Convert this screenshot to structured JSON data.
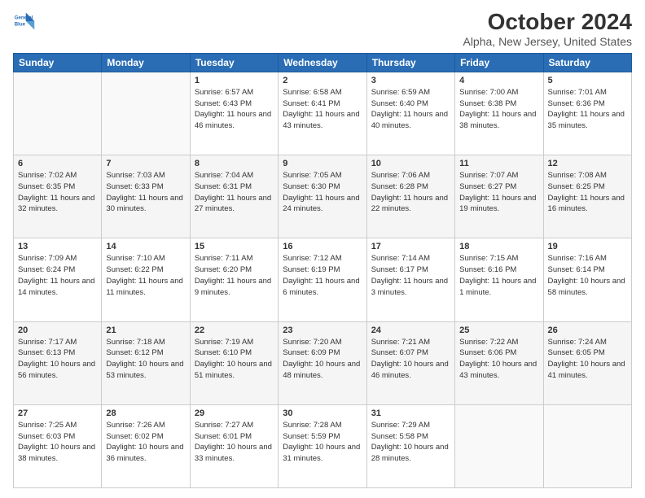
{
  "logo": {
    "line1": "General",
    "line2": "Blue"
  },
  "title": "October 2024",
  "subtitle": "Alpha, New Jersey, United States",
  "days_of_week": [
    "Sunday",
    "Monday",
    "Tuesday",
    "Wednesday",
    "Thursday",
    "Friday",
    "Saturday"
  ],
  "weeks": [
    [
      {
        "day": "",
        "info": ""
      },
      {
        "day": "",
        "info": ""
      },
      {
        "day": "1",
        "info": "Sunrise: 6:57 AM\nSunset: 6:43 PM\nDaylight: 11 hours and 46 minutes."
      },
      {
        "day": "2",
        "info": "Sunrise: 6:58 AM\nSunset: 6:41 PM\nDaylight: 11 hours and 43 minutes."
      },
      {
        "day": "3",
        "info": "Sunrise: 6:59 AM\nSunset: 6:40 PM\nDaylight: 11 hours and 40 minutes."
      },
      {
        "day": "4",
        "info": "Sunrise: 7:00 AM\nSunset: 6:38 PM\nDaylight: 11 hours and 38 minutes."
      },
      {
        "day": "5",
        "info": "Sunrise: 7:01 AM\nSunset: 6:36 PM\nDaylight: 11 hours and 35 minutes."
      }
    ],
    [
      {
        "day": "6",
        "info": "Sunrise: 7:02 AM\nSunset: 6:35 PM\nDaylight: 11 hours and 32 minutes."
      },
      {
        "day": "7",
        "info": "Sunrise: 7:03 AM\nSunset: 6:33 PM\nDaylight: 11 hours and 30 minutes."
      },
      {
        "day": "8",
        "info": "Sunrise: 7:04 AM\nSunset: 6:31 PM\nDaylight: 11 hours and 27 minutes."
      },
      {
        "day": "9",
        "info": "Sunrise: 7:05 AM\nSunset: 6:30 PM\nDaylight: 11 hours and 24 minutes."
      },
      {
        "day": "10",
        "info": "Sunrise: 7:06 AM\nSunset: 6:28 PM\nDaylight: 11 hours and 22 minutes."
      },
      {
        "day": "11",
        "info": "Sunrise: 7:07 AM\nSunset: 6:27 PM\nDaylight: 11 hours and 19 minutes."
      },
      {
        "day": "12",
        "info": "Sunrise: 7:08 AM\nSunset: 6:25 PM\nDaylight: 11 hours and 16 minutes."
      }
    ],
    [
      {
        "day": "13",
        "info": "Sunrise: 7:09 AM\nSunset: 6:24 PM\nDaylight: 11 hours and 14 minutes."
      },
      {
        "day": "14",
        "info": "Sunrise: 7:10 AM\nSunset: 6:22 PM\nDaylight: 11 hours and 11 minutes."
      },
      {
        "day": "15",
        "info": "Sunrise: 7:11 AM\nSunset: 6:20 PM\nDaylight: 11 hours and 9 minutes."
      },
      {
        "day": "16",
        "info": "Sunrise: 7:12 AM\nSunset: 6:19 PM\nDaylight: 11 hours and 6 minutes."
      },
      {
        "day": "17",
        "info": "Sunrise: 7:14 AM\nSunset: 6:17 PM\nDaylight: 11 hours and 3 minutes."
      },
      {
        "day": "18",
        "info": "Sunrise: 7:15 AM\nSunset: 6:16 PM\nDaylight: 11 hours and 1 minute."
      },
      {
        "day": "19",
        "info": "Sunrise: 7:16 AM\nSunset: 6:14 PM\nDaylight: 10 hours and 58 minutes."
      }
    ],
    [
      {
        "day": "20",
        "info": "Sunrise: 7:17 AM\nSunset: 6:13 PM\nDaylight: 10 hours and 56 minutes."
      },
      {
        "day": "21",
        "info": "Sunrise: 7:18 AM\nSunset: 6:12 PM\nDaylight: 10 hours and 53 minutes."
      },
      {
        "day": "22",
        "info": "Sunrise: 7:19 AM\nSunset: 6:10 PM\nDaylight: 10 hours and 51 minutes."
      },
      {
        "day": "23",
        "info": "Sunrise: 7:20 AM\nSunset: 6:09 PM\nDaylight: 10 hours and 48 minutes."
      },
      {
        "day": "24",
        "info": "Sunrise: 7:21 AM\nSunset: 6:07 PM\nDaylight: 10 hours and 46 minutes."
      },
      {
        "day": "25",
        "info": "Sunrise: 7:22 AM\nSunset: 6:06 PM\nDaylight: 10 hours and 43 minutes."
      },
      {
        "day": "26",
        "info": "Sunrise: 7:24 AM\nSunset: 6:05 PM\nDaylight: 10 hours and 41 minutes."
      }
    ],
    [
      {
        "day": "27",
        "info": "Sunrise: 7:25 AM\nSunset: 6:03 PM\nDaylight: 10 hours and 38 minutes."
      },
      {
        "day": "28",
        "info": "Sunrise: 7:26 AM\nSunset: 6:02 PM\nDaylight: 10 hours and 36 minutes."
      },
      {
        "day": "29",
        "info": "Sunrise: 7:27 AM\nSunset: 6:01 PM\nDaylight: 10 hours and 33 minutes."
      },
      {
        "day": "30",
        "info": "Sunrise: 7:28 AM\nSunset: 5:59 PM\nDaylight: 10 hours and 31 minutes."
      },
      {
        "day": "31",
        "info": "Sunrise: 7:29 AM\nSunset: 5:58 PM\nDaylight: 10 hours and 28 minutes."
      },
      {
        "day": "",
        "info": ""
      },
      {
        "day": "",
        "info": ""
      }
    ]
  ]
}
